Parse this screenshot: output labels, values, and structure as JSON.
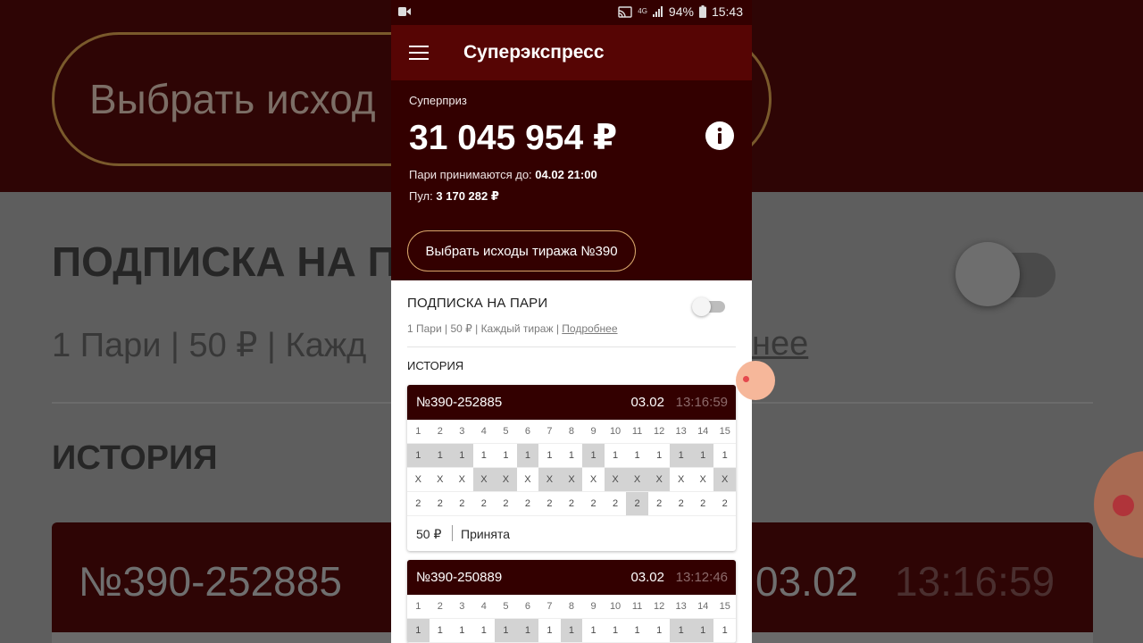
{
  "status_bar": {
    "network": "4G",
    "battery": "94%",
    "time": "15:43"
  },
  "app_bar": {
    "title": "Суперэкспресс"
  },
  "hero": {
    "label": "Суперприз",
    "amount": "31 045 954 ₽",
    "deadline_label": "Пари принимаются до:",
    "deadline_value": "04.02 21:00",
    "pool_label": "Пул:",
    "pool_value": "3 170 282 ₽",
    "select_button": "Выбрать исходы тиража №390"
  },
  "subscription": {
    "title": "ПОДПИСКА НА ПАРИ",
    "details": "1 Пари | 50 ₽ | Каждый тираж |",
    "more_link": "Подробнее",
    "enabled": false
  },
  "history": {
    "title": "ИСТОРИЯ",
    "columns": [
      "1",
      "2",
      "3",
      "4",
      "5",
      "6",
      "7",
      "8",
      "9",
      "10",
      "11",
      "12",
      "13",
      "14",
      "15"
    ],
    "row_labels": [
      "1",
      "X",
      "2"
    ],
    "bets": [
      {
        "id": "№390-252885",
        "date": "03.02",
        "time": "13:16:59",
        "selected_outcomes": [
          "1",
          "1",
          "1",
          "X",
          "X",
          "1",
          "X",
          "X",
          "1",
          "X",
          "X",
          "X",
          "1",
          "1",
          "X"
        ],
        "second_outcomes": [
          "",
          "",
          "",
          "",
          "",
          "",
          "",
          "",
          "",
          "",
          "2",
          "",
          "",
          "",
          ""
        ],
        "amount": "50 ₽",
        "status": "Принята"
      },
      {
        "id": "№390-250889",
        "date": "03.02",
        "time": "13:12:46",
        "selected_outcomes": [
          "1",
          "",
          "",
          "",
          "1",
          "1",
          "",
          "1",
          "",
          "",
          "",
          "",
          "1",
          "1",
          ""
        ],
        "second_outcomes": [
          "",
          "",
          "",
          "",
          "",
          "",
          "",
          "",
          "",
          "",
          "",
          "",
          "",
          "",
          ""
        ],
        "amount": "",
        "status": ""
      }
    ]
  },
  "background_zoom": {
    "pill_text": "Выбрать исход",
    "sub_title": "ПОДПИСКА НА П",
    "sub_line": "1 Пари | 50 ₽ | Кажд",
    "sub_more": "нее",
    "hist_title": "ИСТОРИЯ",
    "card_id": "№390-252885",
    "card_date": "03.02",
    "card_time": "13:16:59"
  },
  "colors": {
    "app_bar": "#560504",
    "hero": "#330000",
    "card_header": "#330000",
    "pill_border": "#d8a66b",
    "selected_cell": "#d3d3d3"
  }
}
